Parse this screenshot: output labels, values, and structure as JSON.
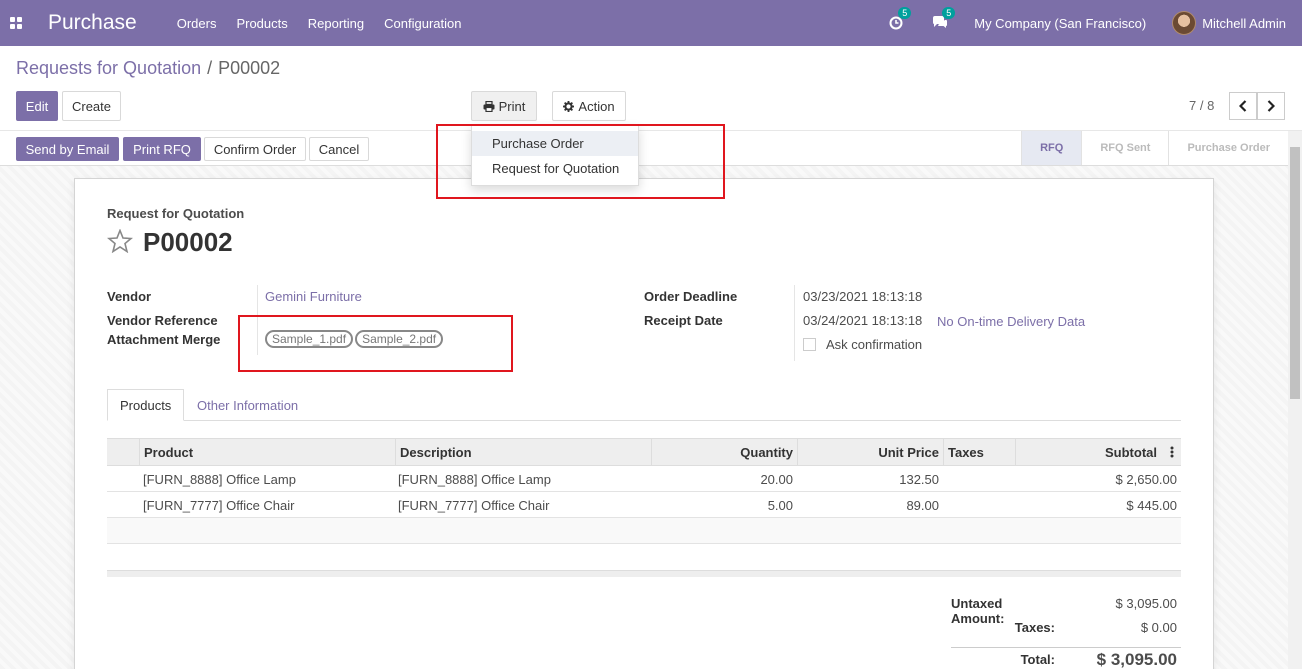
{
  "navbar": {
    "brand": "Purchase",
    "menu": [
      "Orders",
      "Products",
      "Reporting",
      "Configuration"
    ],
    "activity_count": "5",
    "messages_count": "5",
    "company": "My Company (San Francisco)",
    "user": "Mitchell Admin"
  },
  "breadcrumb": {
    "parent": "Requests for Quotation",
    "separator": "/",
    "current": "P00002"
  },
  "buttons": {
    "edit": "Edit",
    "create": "Create",
    "print": "Print",
    "action": "Action",
    "send_email": "Send by Email",
    "print_rfq": "Print RFQ",
    "confirm_order": "Confirm Order",
    "cancel": "Cancel"
  },
  "pager": {
    "value": "7 / 8"
  },
  "status_steps": [
    {
      "label": "RFQ",
      "active": true
    },
    {
      "label": "RFQ Sent",
      "active": false
    },
    {
      "label": "Purchase Order",
      "active": false
    }
  ],
  "print_menu": [
    "Purchase Order",
    "Request for Quotation"
  ],
  "form": {
    "doc_type": "Request for Quotation",
    "doc_name": "P00002",
    "vendor_label": "Vendor",
    "vendor": "Gemini Furniture",
    "vendor_ref_label": "Vendor Reference",
    "attachment_label": "Attachment Merge",
    "attachments": [
      "Sample_1.pdf",
      "Sample_2.pdf"
    ],
    "deadline_label": "Order Deadline",
    "deadline": "03/23/2021 18:13:18",
    "receipt_label": "Receipt Date",
    "receipt": "03/24/2021 18:13:18",
    "ontime": "No On-time Delivery Data",
    "ask_confirmation": "Ask confirmation"
  },
  "tabs": [
    "Products",
    "Other Information"
  ],
  "table": {
    "columns": [
      "Product",
      "Description",
      "Quantity",
      "Unit Price",
      "Taxes",
      "Subtotal"
    ],
    "rows": [
      {
        "product": "[FURN_8888] Office Lamp",
        "description": "[FURN_8888] Office Lamp",
        "quantity": "20.00",
        "unit_price": "132.50",
        "taxes": "",
        "subtotal": "$ 2,650.00"
      },
      {
        "product": "[FURN_7777] Office Chair",
        "description": "[FURN_7777] Office Chair",
        "quantity": "5.00",
        "unit_price": "89.00",
        "taxes": "",
        "subtotal": "$ 445.00"
      }
    ]
  },
  "totals": {
    "untaxed_label": "Untaxed Amount:",
    "untaxed": "$ 3,095.00",
    "taxes_label": "Taxes:",
    "taxes": "$ 0.00",
    "total_label": "Total:",
    "total": "$ 3,095.00"
  },
  "colors": {
    "accent": "#7c6fa8",
    "highlight": "#e0161e",
    "badge": "#00a09d"
  }
}
